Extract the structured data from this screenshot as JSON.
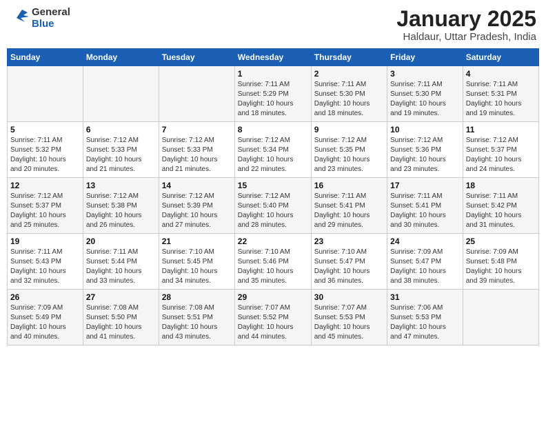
{
  "header": {
    "logo_general": "General",
    "logo_blue": "Blue",
    "title": "January 2025",
    "subtitle": "Haldaur, Uttar Pradesh, India"
  },
  "days_of_week": [
    "Sunday",
    "Monday",
    "Tuesday",
    "Wednesday",
    "Thursday",
    "Friday",
    "Saturday"
  ],
  "weeks": [
    [
      {
        "day": "",
        "info": ""
      },
      {
        "day": "",
        "info": ""
      },
      {
        "day": "",
        "info": ""
      },
      {
        "day": "1",
        "info": "Sunrise: 7:11 AM\nSunset: 5:29 PM\nDaylight: 10 hours\nand 18 minutes."
      },
      {
        "day": "2",
        "info": "Sunrise: 7:11 AM\nSunset: 5:30 PM\nDaylight: 10 hours\nand 18 minutes."
      },
      {
        "day": "3",
        "info": "Sunrise: 7:11 AM\nSunset: 5:30 PM\nDaylight: 10 hours\nand 19 minutes."
      },
      {
        "day": "4",
        "info": "Sunrise: 7:11 AM\nSunset: 5:31 PM\nDaylight: 10 hours\nand 19 minutes."
      }
    ],
    [
      {
        "day": "5",
        "info": "Sunrise: 7:11 AM\nSunset: 5:32 PM\nDaylight: 10 hours\nand 20 minutes."
      },
      {
        "day": "6",
        "info": "Sunrise: 7:12 AM\nSunset: 5:33 PM\nDaylight: 10 hours\nand 21 minutes."
      },
      {
        "day": "7",
        "info": "Sunrise: 7:12 AM\nSunset: 5:33 PM\nDaylight: 10 hours\nand 21 minutes."
      },
      {
        "day": "8",
        "info": "Sunrise: 7:12 AM\nSunset: 5:34 PM\nDaylight: 10 hours\nand 22 minutes."
      },
      {
        "day": "9",
        "info": "Sunrise: 7:12 AM\nSunset: 5:35 PM\nDaylight: 10 hours\nand 23 minutes."
      },
      {
        "day": "10",
        "info": "Sunrise: 7:12 AM\nSunset: 5:36 PM\nDaylight: 10 hours\nand 23 minutes."
      },
      {
        "day": "11",
        "info": "Sunrise: 7:12 AM\nSunset: 5:37 PM\nDaylight: 10 hours\nand 24 minutes."
      }
    ],
    [
      {
        "day": "12",
        "info": "Sunrise: 7:12 AM\nSunset: 5:37 PM\nDaylight: 10 hours\nand 25 minutes."
      },
      {
        "day": "13",
        "info": "Sunrise: 7:12 AM\nSunset: 5:38 PM\nDaylight: 10 hours\nand 26 minutes."
      },
      {
        "day": "14",
        "info": "Sunrise: 7:12 AM\nSunset: 5:39 PM\nDaylight: 10 hours\nand 27 minutes."
      },
      {
        "day": "15",
        "info": "Sunrise: 7:12 AM\nSunset: 5:40 PM\nDaylight: 10 hours\nand 28 minutes."
      },
      {
        "day": "16",
        "info": "Sunrise: 7:11 AM\nSunset: 5:41 PM\nDaylight: 10 hours\nand 29 minutes."
      },
      {
        "day": "17",
        "info": "Sunrise: 7:11 AM\nSunset: 5:41 PM\nDaylight: 10 hours\nand 30 minutes."
      },
      {
        "day": "18",
        "info": "Sunrise: 7:11 AM\nSunset: 5:42 PM\nDaylight: 10 hours\nand 31 minutes."
      }
    ],
    [
      {
        "day": "19",
        "info": "Sunrise: 7:11 AM\nSunset: 5:43 PM\nDaylight: 10 hours\nand 32 minutes."
      },
      {
        "day": "20",
        "info": "Sunrise: 7:11 AM\nSunset: 5:44 PM\nDaylight: 10 hours\nand 33 minutes."
      },
      {
        "day": "21",
        "info": "Sunrise: 7:10 AM\nSunset: 5:45 PM\nDaylight: 10 hours\nand 34 minutes."
      },
      {
        "day": "22",
        "info": "Sunrise: 7:10 AM\nSunset: 5:46 PM\nDaylight: 10 hours\nand 35 minutes."
      },
      {
        "day": "23",
        "info": "Sunrise: 7:10 AM\nSunset: 5:47 PM\nDaylight: 10 hours\nand 36 minutes."
      },
      {
        "day": "24",
        "info": "Sunrise: 7:09 AM\nSunset: 5:47 PM\nDaylight: 10 hours\nand 38 minutes."
      },
      {
        "day": "25",
        "info": "Sunrise: 7:09 AM\nSunset: 5:48 PM\nDaylight: 10 hours\nand 39 minutes."
      }
    ],
    [
      {
        "day": "26",
        "info": "Sunrise: 7:09 AM\nSunset: 5:49 PM\nDaylight: 10 hours\nand 40 minutes."
      },
      {
        "day": "27",
        "info": "Sunrise: 7:08 AM\nSunset: 5:50 PM\nDaylight: 10 hours\nand 41 minutes."
      },
      {
        "day": "28",
        "info": "Sunrise: 7:08 AM\nSunset: 5:51 PM\nDaylight: 10 hours\nand 43 minutes."
      },
      {
        "day": "29",
        "info": "Sunrise: 7:07 AM\nSunset: 5:52 PM\nDaylight: 10 hours\nand 44 minutes."
      },
      {
        "day": "30",
        "info": "Sunrise: 7:07 AM\nSunset: 5:53 PM\nDaylight: 10 hours\nand 45 minutes."
      },
      {
        "day": "31",
        "info": "Sunrise: 7:06 AM\nSunset: 5:53 PM\nDaylight: 10 hours\nand 47 minutes."
      },
      {
        "day": "",
        "info": ""
      }
    ]
  ]
}
